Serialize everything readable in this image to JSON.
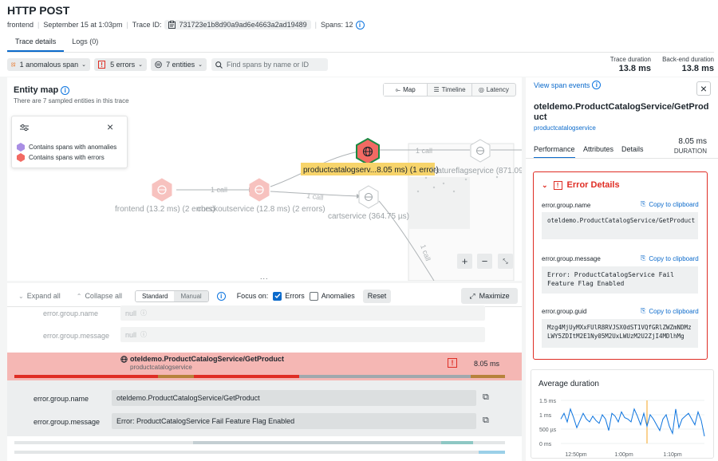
{
  "header": {
    "title": "HTTP POST",
    "entity": "frontend",
    "timestamp": "September 15 at 1:03pm",
    "trace_id_label": "Trace ID:",
    "trace_id": "731723e1b8d90a9ad6e4663a2ad19489",
    "spans": "Spans: 12"
  },
  "tabs": [
    {
      "label": "Trace details"
    },
    {
      "label": "Logs (0)"
    }
  ],
  "filters": {
    "anomalous": "1 anomalous span",
    "errors": "5 errors",
    "entities": "7 entities",
    "search_placeholder": "Find spans by name or ID"
  },
  "stats": {
    "trace_duration_label": "Trace duration",
    "trace_duration": "13.8 ms",
    "backend_duration_label": "Back-end duration",
    "backend_duration": "13.8 ms"
  },
  "entity_map": {
    "title": "Entity map",
    "subtitle": "There are 7 sampled entities in this trace",
    "views": [
      "Map",
      "Timeline",
      "Latency"
    ],
    "legend": {
      "anomalies": "Contains spans with anomalies",
      "errors": "Contains spans with errors"
    },
    "nodes": {
      "frontend": "frontend (13.2 ms) (2 errors)",
      "checkout": "checkoutservice (12.8 ms) (2 errors)",
      "productcatalog": "productcatalogserv...8.05 ms) (1 error)",
      "cart": "cartservice (364.75 µs)",
      "featureflag": "featureflagservice (871.09 µ"
    },
    "edges": {
      "e1": "1 call",
      "e2": "1 call",
      "e3": "1 call",
      "e4": "1 call",
      "e5": "1 call"
    },
    "zoom_in": "+",
    "zoom_out": "−",
    "drag_handle": "..."
  },
  "toolbar": {
    "expand_all": "Expand all",
    "collapse_all": "Collapse all",
    "standard": "Standard",
    "manual": "Manual",
    "focus_on": "Focus on:",
    "errors": "Errors",
    "anomalies": "Anomalies",
    "reset": "Reset",
    "maximize": "Maximize"
  },
  "span_list": {
    "faded_rows": [
      {
        "key": "error.group.name",
        "value": "null"
      },
      {
        "key": "error.group.message",
        "value": "null"
      }
    ],
    "selected_span": {
      "name": "oteldemo.ProductCatalogService/GetProduct",
      "service": "productcatalogservice",
      "duration": "8.05 ms",
      "duration_fraction": 0.58
    },
    "attributes": [
      {
        "key": "error.group.name",
        "value": "oteldemo.ProductCatalogService/GetProduct"
      },
      {
        "key": "error.group.message",
        "value": "Error: ProductCatalogService Fail Feature Flag Enabled"
      }
    ]
  },
  "side": {
    "view_span_events": "View span events",
    "span_title": "oteldemo.ProductCatalogService/GetProduct",
    "service_link": "productcatalogservice",
    "tabs": [
      "Performance",
      "Attributes",
      "Details"
    ],
    "duration": "8.05 ms",
    "duration_label": "DURATION",
    "error_details": {
      "title": "Error Details",
      "copy_label": "Copy to clipboard",
      "fields": [
        {
          "key": "error.group.name",
          "value": "oteldemo.ProductCatalogService/GetProduct"
        },
        {
          "key": "error.group.message",
          "value": "Error: ProductCatalogService Fail Feature Flag Enabled"
        },
        {
          "key": "error.group.guid",
          "value": "Mzg4MjUyMXxFUlR8RVJSX0dST1VQfGRlZWZmNDMzLWY5ZDItM2E1Ny05M2UxLWUzM2U2ZjI4MDlhMg"
        }
      ]
    }
  },
  "chart_data": {
    "type": "line",
    "title": "Average duration",
    "yticks": [
      "1.5 ms",
      "1 ms",
      "500 µs",
      "0 ms"
    ],
    "xticks": [
      "12:50pm",
      "1:00pm",
      "1:10pm"
    ],
    "ylim": [
      0,
      1.5
    ],
    "ylabel_unit": "ms",
    "series": [
      {
        "values": [
          0.85,
          1.05,
          0.75,
          1.2,
          0.9,
          0.55,
          0.8,
          1.05,
          0.85,
          0.75,
          0.95,
          0.8,
          0.7,
          1.0,
          0.85,
          0.45,
          1.05,
          0.95,
          0.75,
          1.1,
          0.9,
          0.85,
          0.75,
          1.2,
          0.95,
          0.65,
          1.05,
          0.6,
          1.0,
          0.85,
          0.65,
          0.45,
          0.85,
          1.0,
          0.6,
          0.35,
          1.2,
          0.55,
          0.85,
          0.95,
          1.05,
          0.85,
          0.65,
          1.1,
          0.8,
          0.25
        ]
      }
    ],
    "marker_fraction": 0.6,
    "colors": {
      "line": "#0c74df",
      "marker": "#f5a623"
    }
  },
  "colors": {
    "error": "#df2d24",
    "accent": "#0b6acb",
    "highlight": "#f7d46b",
    "selected_row": "#f5b7b4",
    "anomaly": "#a98ee4"
  }
}
